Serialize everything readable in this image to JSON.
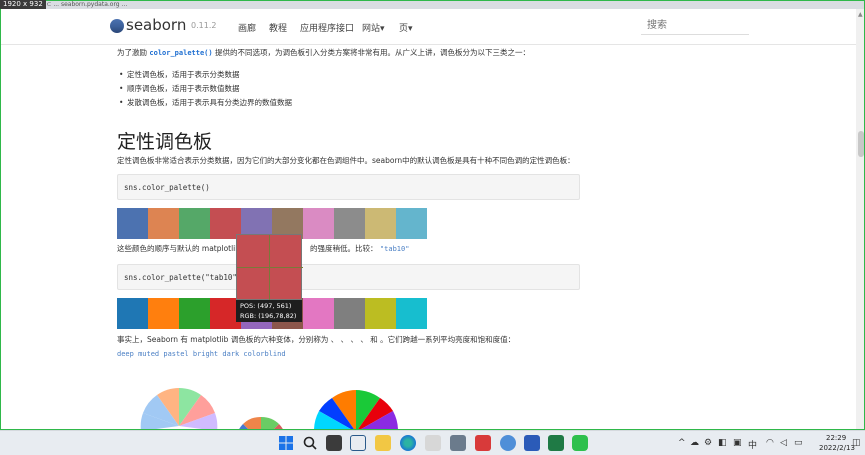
{
  "capture": {
    "size_label": "1920 x 932"
  },
  "topstrip": {
    "text": "k ⊂ ... seaborn.pydata.org ..."
  },
  "navbar": {
    "logo_text": "seaborn",
    "version": "0.11.2",
    "items": [
      "画廊",
      "教程",
      "应用程序接口",
      "网站▾",
      "页▾"
    ],
    "search_placeholder": "搜索"
  },
  "intro": {
    "part1": "为了激励 ",
    "code": "color_palette()",
    "part2": " 提供的不同选项，为调色板引入分类方案将非常有用。从广义上讲，调色板分为以下三类之一："
  },
  "bullets": [
    "定性调色板，适用于表示分类数据",
    "顺序调色板，适用于表示数值数据",
    "发散调色板，适用于表示具有分类边界的数值数据"
  ],
  "heading": "定性调色板",
  "para1": "定性调色板非常适合表示分类数据，因为它们的大部分变化都在色调组件中。seaborn中的默认调色板是具有十种不同色调的定性调色板：",
  "code1": "sns.color_palette()",
  "palette_default": [
    "#4c72b0",
    "#dd8452",
    "#55a868",
    "#c44e52",
    "#8172b3",
    "#937860",
    "#da8bc3",
    "#8c8c8c",
    "#ccb974",
    "#64b5cd"
  ],
  "para2": {
    "part1": "这些颜色的顺序与默认的 matplotlib",
    "part2": "的强度稍低。比较：",
    "code": "\"tab10\""
  },
  "code2": "sns.color_palette(\"tab10\")",
  "palette_tab10": [
    "#1f77b4",
    "#ff7f0e",
    "#2ca02c",
    "#d62728",
    "#9467bd",
    "#8c564b",
    "#e377c2",
    "#7f7f7f",
    "#bcbd22",
    "#17becf"
  ],
  "para3": "事实上，Seaborn 有 matplotlib 调色板的六种变体，分别称为 、 、 、 、 和 。它们跨越一系列平均亮度和饱和度值：",
  "variants": "deep muted pastel bright dark colorblind",
  "zoom": {
    "pos": "POS: (497, 561)",
    "rgb": "RGB: (196,78,82)",
    "color": "#c44e52"
  },
  "taskbar": {
    "time": "22:29",
    "date": "2022/2/13",
    "lang": "中"
  }
}
